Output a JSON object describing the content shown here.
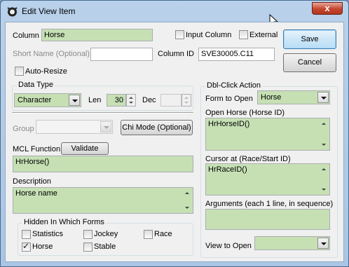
{
  "window": {
    "title": "Edit View Item",
    "close_glyph": "x"
  },
  "column": {
    "label": "Column",
    "value": "Horse",
    "input_column_label": "Input Column",
    "input_column_checked": false,
    "external_label": "External",
    "external_checked": false
  },
  "short_name": {
    "label": "Short Name (Optional)",
    "value": ""
  },
  "column_id": {
    "label": "Column ID",
    "value": "SVE30005.C11"
  },
  "auto_resize": {
    "label": "Auto-Resize",
    "checked": false
  },
  "buttons": {
    "save": "Save",
    "cancel": "Cancel"
  },
  "data_type": {
    "title": "Data Type",
    "value": "Character",
    "len_label": "Len",
    "len_value": "30",
    "dec_label": "Dec",
    "dec_value": ""
  },
  "group": {
    "label": "Group",
    "value": "",
    "chi_mode_button": "Chi Mode (Optional)"
  },
  "mcl": {
    "label": "MCL Function",
    "validate_button": "Validate",
    "value": "HrHorse()"
  },
  "description": {
    "label": "Description",
    "value": "Horse name"
  },
  "hidden_forms": {
    "title": "Hidden In Which Forms",
    "items": [
      {
        "label": "Statistics",
        "checked": false
      },
      {
        "label": "Jockey",
        "checked": false
      },
      {
        "label": "Race",
        "checked": false
      },
      {
        "label": "Horse",
        "checked": true
      },
      {
        "label": "Stable",
        "checked": false
      }
    ]
  },
  "dbl_click": {
    "title": "Dbl-Click Action",
    "form_to_open_label": "Form to Open",
    "form_to_open_value": "Horse",
    "open_label": "Open Horse (Horse ID)",
    "open_value": "HrHorseID()",
    "cursor_label": "Cursor at (Race/Start ID)",
    "cursor_value": "HrRaceID()",
    "arguments_label": "Arguments (each 1 line, in sequence)",
    "arguments_value": "",
    "view_to_open_label": "View to Open",
    "view_to_open_value": ""
  },
  "icons": [
    "app-icon",
    "close-icon",
    "mouse-pointer-icon",
    "checkmark-icon",
    "dropdown-arrow-icon",
    "scroll-arrow-icon"
  ]
}
